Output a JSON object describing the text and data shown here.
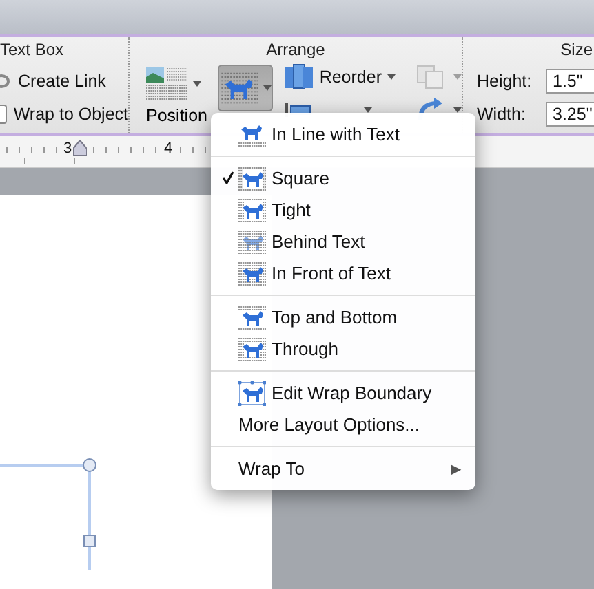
{
  "ribbon": {
    "text_box": {
      "title": "Text Box",
      "create_link": "Create Link",
      "wrap_to_object": {
        "label": "Wrap to Object",
        "checked": false
      }
    },
    "arrange": {
      "title": "Arrange",
      "position": "Position",
      "reorder": "Reorder"
    },
    "size": {
      "title": "Size",
      "height_label": "Height:",
      "height_value": "1.5\"",
      "width_label": "Width:",
      "width_value": "3.25\""
    }
  },
  "ruler": {
    "labels": [
      "3",
      "4"
    ]
  },
  "menu": {
    "sections": [
      [
        {
          "label": "In Line with Text",
          "kind": "inline",
          "checked": false
        }
      ],
      [
        {
          "label": "Square",
          "kind": "square",
          "checked": true
        },
        {
          "label": "Tight",
          "kind": "tight",
          "checked": false
        },
        {
          "label": "Behind Text",
          "kind": "behind",
          "checked": false
        },
        {
          "label": "In Front of Text",
          "kind": "front",
          "checked": false
        }
      ],
      [
        {
          "label": "Top and Bottom",
          "kind": "topbottom",
          "checked": false
        },
        {
          "label": "Through",
          "kind": "through",
          "checked": false
        }
      ],
      [
        {
          "label": "Edit Wrap Boundary",
          "kind": "boundary",
          "checked": false
        },
        {
          "label": "More Layout Options...",
          "kind": "plain",
          "checked": false
        }
      ],
      [
        {
          "label": "Wrap To",
          "kind": "submenu",
          "checked": false,
          "arrow": "▶"
        }
      ]
    ]
  }
}
